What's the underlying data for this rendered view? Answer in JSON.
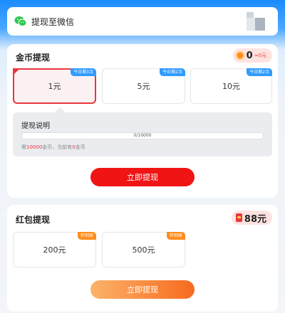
{
  "wechat_bar": {
    "label": "提现至微信"
  },
  "coin_section": {
    "title": "金币提现",
    "balance": "0",
    "balance_unit": "≈0元",
    "options": [
      {
        "amount": "1元",
        "tag": "今日剩3次",
        "selected": true
      },
      {
        "amount": "5元",
        "tag": "今日剩2次",
        "selected": false
      },
      {
        "amount": "10元",
        "tag": "今日剩2次",
        "selected": false
      }
    ],
    "note": {
      "title": "提现说明",
      "progress_text": "0/10000",
      "progress_fraction": 0,
      "desc_prefix": "需",
      "desc_need": "10000",
      "desc_mid": "金币，当前有",
      "desc_have": "0",
      "desc_suffix": "金币"
    },
    "button": "立即提现"
  },
  "redpacket_section": {
    "title": "红包提现",
    "balance": "88元",
    "options": [
      {
        "amount": "200元",
        "tag": "秒到账"
      },
      {
        "amount": "500元",
        "tag": "秒到账"
      }
    ],
    "button": "立即提现"
  },
  "colors": {
    "accent_red": "#f01414",
    "blue_tag": "#2f9bff",
    "orange_tag": "#ff8c1a"
  }
}
